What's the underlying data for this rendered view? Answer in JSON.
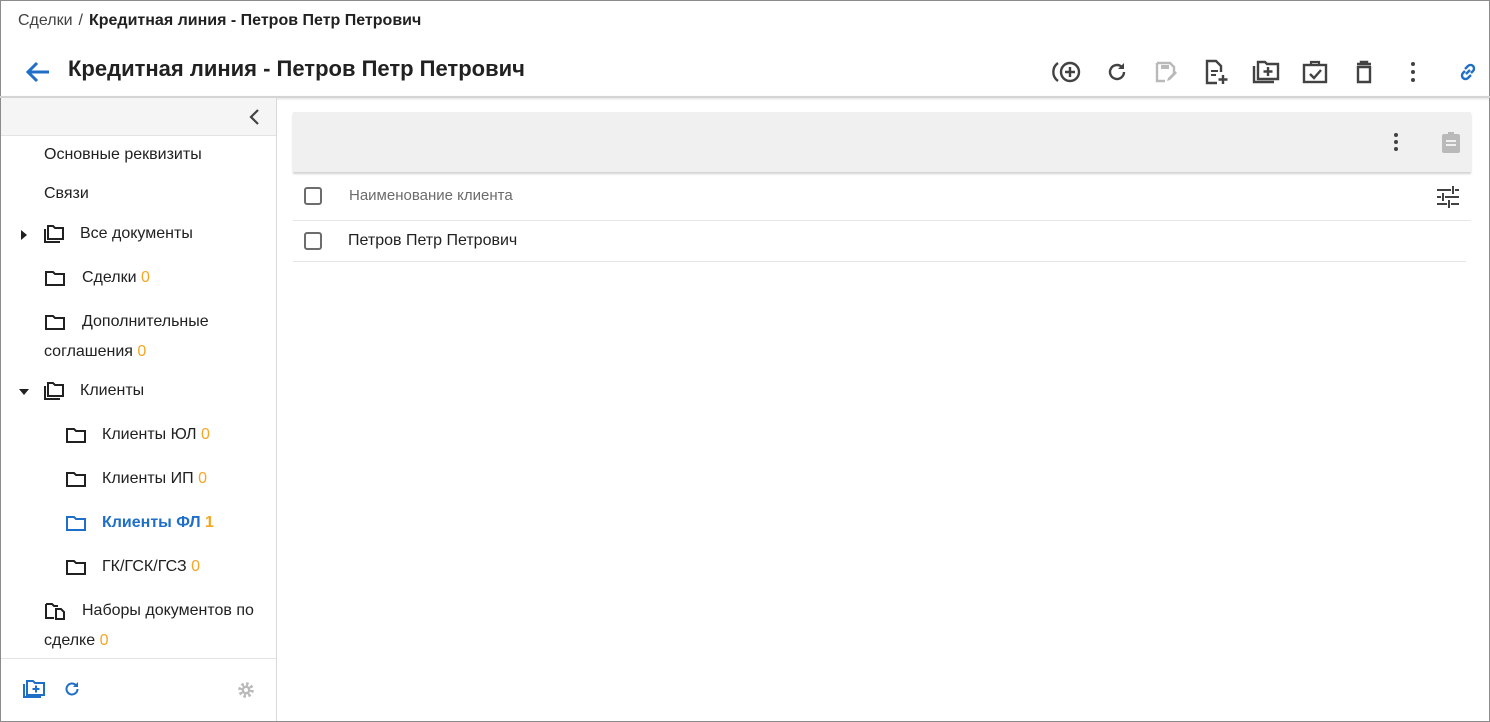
{
  "breadcrumb": {
    "root": "Сделки",
    "separator": "/",
    "current": "Кредитная линия - Петров Петр Петрович"
  },
  "header": {
    "title": "Кредитная линия - Петров Петр Петрович",
    "accent_color": "#1f6fc9",
    "toolbar": [
      "add-circle-icon",
      "refresh-icon",
      "edit-save-icon",
      "add-document-icon",
      "add-folder-icon",
      "task-check-icon",
      "delete-icon",
      "more-vert-icon",
      "link-icon"
    ]
  },
  "sidebar": {
    "items": [
      {
        "label": "Основные реквизиты"
      },
      {
        "label": "Связи"
      },
      {
        "label": "Все документы"
      },
      {
        "label": "Сделки",
        "count": "0"
      },
      {
        "label": "Дополнительные",
        "label2": "соглашения",
        "count": "0"
      },
      {
        "label": "Клиенты"
      },
      {
        "label": "Клиенты ЮЛ",
        "count": "0"
      },
      {
        "label": "Клиенты ИП",
        "count": "0"
      },
      {
        "label": "Клиенты ФЛ",
        "count": "1",
        "active": true
      },
      {
        "label": "ГК/ГСК/ГСЗ",
        "count": "0"
      },
      {
        "label": "Наборы документов по",
        "label2": "сделке",
        "count": "0"
      }
    ],
    "count_color": "#f5a623"
  },
  "table": {
    "column_header": "Наименование клиента",
    "rows": [
      {
        "name": "Петров Петр Петрович"
      }
    ]
  }
}
